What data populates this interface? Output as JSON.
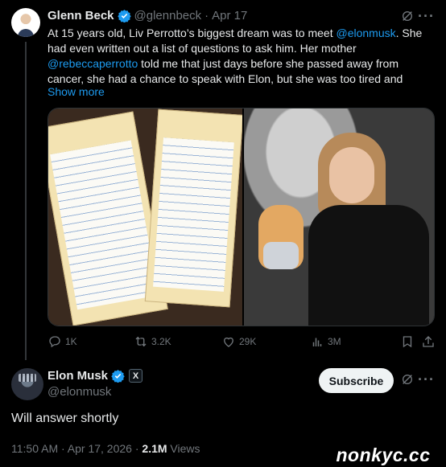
{
  "original_tweet": {
    "author_name": "Glenn Beck",
    "author_handle": "@glennbeck",
    "separator": "·",
    "date": "Apr 17",
    "text_segments": [
      "At 15 years old, Liv Perrotto’s biggest dream was to meet ",
      "@elonmusk",
      ". She had even written out a list of questions to ask him. Her mother ",
      "@rebeccaperrotto",
      " told me that just days before she passed away from cancer, she had a chance to speak with Elon, but she was too tired and"
    ],
    "show_more": "Show more",
    "more_icon": "···",
    "stats": {
      "replies": "1K",
      "retweets": "3.2K",
      "likes": "29K",
      "views": "3M"
    }
  },
  "reply_tweet": {
    "author_name": "Elon Musk",
    "author_handle": "@elonmusk",
    "affiliate_badge": "X",
    "subscribe_label": "Subscribe",
    "text": "Will answer shortly",
    "timestamp": "11:50 AM · Apr 17, 2026 · ",
    "views_count": "2.1M",
    "views_label": " Views"
  },
  "watermark": "nonkyc.cc",
  "colors": {
    "background": "#000000",
    "text": "#e7e9ea",
    "muted": "#71767b",
    "link": "#1d9bf0",
    "verified": "#1d9bf0"
  },
  "icons": [
    "verified-badge-icon",
    "grok-icon",
    "more-icon",
    "reply-icon",
    "retweet-icon",
    "like-icon",
    "views-icon",
    "bookmark-icon",
    "share-icon"
  ]
}
